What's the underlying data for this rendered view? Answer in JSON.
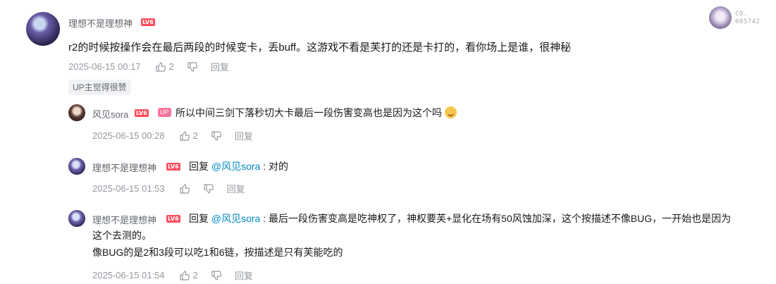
{
  "comment": {
    "user": "理想不是理想神",
    "level": "LV6",
    "text": "r2的时候按操作会在最后两段的时候变卡，丢buff。这游戏不看是芙打的还是卡打的，看你场上是谁，很神秘",
    "time": "2025-06-15 00:17",
    "likes": "2",
    "reply_label": "回复",
    "up_tag": "UP主觉得很赞"
  },
  "corner": {
    "line1": "CO.",
    "line2": "005742"
  },
  "replies": [
    {
      "user": "风见sora",
      "level": "LV6",
      "up_badge": "UP",
      "text": "所以中间三剑下落秒切大卡最后一段伤害变高也是因为这个吗",
      "time": "2025-06-15 00:28",
      "likes": "2",
      "reply_label": "回复"
    },
    {
      "user": "理想不是理想神",
      "level": "LV6",
      "prefix": "回复 ",
      "at": "@风见sora",
      "text": " : 对的",
      "time": "2025-06-15 01:53",
      "likes": "",
      "reply_label": "回复"
    },
    {
      "user": "理想不是理想神",
      "level": "LV6",
      "prefix": "回复 ",
      "at": "@风见sora",
      "text": " : 最后一段伤害变高是吃神权了，神权要芙+显化在场有50风蚀加深，这个按描述不像BUG，一开始也是因为",
      "line2": "这个去测的。",
      "line3": "像BUG的是2和3段可以吃1和6链，按描述是只有芙能吃的",
      "time": "2025-06-15 01:54",
      "likes": "2",
      "reply_label": "回复"
    }
  ]
}
